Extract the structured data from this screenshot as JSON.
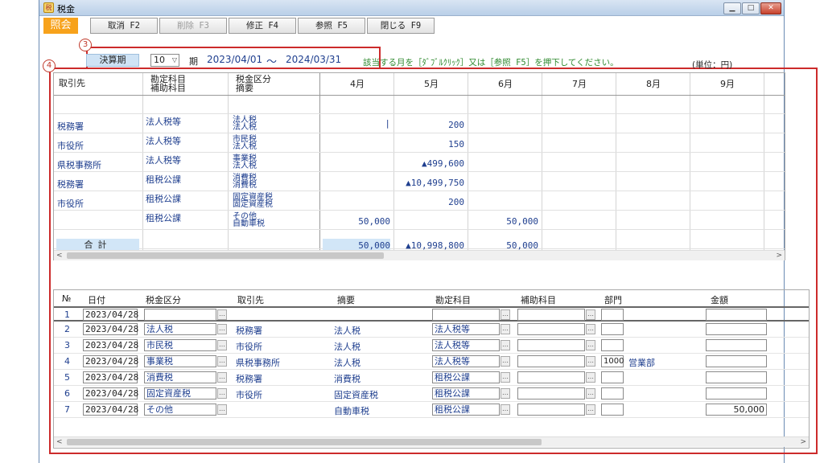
{
  "window": {
    "title": "税金",
    "icon_glyph": "税"
  },
  "mode_badge": "照会",
  "toolbar": [
    {
      "label": "取消 F2",
      "enabled": true
    },
    {
      "label": "削除 F3",
      "enabled": false
    },
    {
      "label": "修正 F4",
      "enabled": true
    },
    {
      "label": "参照 F5",
      "enabled": true
    },
    {
      "label": "閉じる F9",
      "enabled": true
    }
  ],
  "callouts": {
    "c3": "3",
    "c4": "4"
  },
  "period": {
    "label": "決算期",
    "value": "10",
    "unit": "期",
    "from": "2023/04/01",
    "tilde": "〜",
    "to": "2024/03/31"
  },
  "hint": "該当する月を［ﾀﾞﾌﾞﾙｸﾘｯｸ］又は［参照 F5］を押下してください。",
  "unit_note": "(単位：円)",
  "summary": {
    "headers": {
      "partner": "取引先",
      "account": "勘定科目",
      "sub_account": "補助科目",
      "tax_class": "税金区分",
      "memo": "摘要",
      "months": [
        "4月",
        "5月",
        "6月",
        "7月",
        "8月",
        "9月"
      ]
    },
    "rows": [
      {
        "partner": "税務署",
        "account": "法人税等",
        "tax1": "法人税",
        "tax2": "法人税",
        "apr": "|",
        "may": "200",
        "jun": ""
      },
      {
        "partner": "市役所",
        "account": "法人税等",
        "tax1": "市民税",
        "tax2": "法人税",
        "apr": "",
        "may": "150",
        "jun": ""
      },
      {
        "partner": "県税事務所",
        "account": "法人税等",
        "tax1": "事業税",
        "tax2": "法人税",
        "apr": "",
        "may": "▲499,600",
        "jun": ""
      },
      {
        "partner": "税務署",
        "account": "租税公課",
        "tax1": "消費税",
        "tax2": "消費税",
        "apr": "",
        "may": "▲10,499,750",
        "jun": ""
      },
      {
        "partner": "市役所",
        "account": "租税公課",
        "tax1": "固定資産税",
        "tax2": "固定資産税",
        "apr": "",
        "may": "200",
        "jun": ""
      },
      {
        "partner": "",
        "account": "租税公課",
        "tax1": "その他",
        "tax2": "自動車税",
        "apr": "50,000",
        "may": "",
        "jun": "50,000"
      }
    ],
    "total": {
      "label": "合計",
      "apr": "50,000",
      "may": "▲10,998,800",
      "jun": "50,000"
    }
  },
  "detail": {
    "headers": [
      "№",
      "日付",
      "税金区分",
      "取引先",
      "摘要",
      "勘定科目",
      "補助科目",
      "部門",
      "金額"
    ],
    "rows": [
      {
        "no": "1",
        "date": "2023/04/28",
        "tax": "",
        "partner": "",
        "memo": "",
        "account": "",
        "dept_code": "",
        "dept_name": "",
        "amount": ""
      },
      {
        "no": "2",
        "date": "2023/04/28",
        "tax": "法人税",
        "partner": "税務署",
        "memo": "法人税",
        "account": "法人税等",
        "dept_code": "",
        "dept_name": "",
        "amount": ""
      },
      {
        "no": "3",
        "date": "2023/04/28",
        "tax": "市民税",
        "partner": "市役所",
        "memo": "法人税",
        "account": "法人税等",
        "dept_code": "",
        "dept_name": "",
        "amount": ""
      },
      {
        "no": "4",
        "date": "2023/04/28",
        "tax": "事業税",
        "partner": "県税事務所",
        "memo": "法人税",
        "account": "法人税等",
        "dept_code": "1000",
        "dept_name": "営業部",
        "amount": ""
      },
      {
        "no": "5",
        "date": "2023/04/28",
        "tax": "消費税",
        "partner": "税務署",
        "memo": "消費税",
        "account": "租税公課",
        "dept_code": "",
        "dept_name": "",
        "amount": ""
      },
      {
        "no": "6",
        "date": "2023/04/28",
        "tax": "固定資産税",
        "partner": "市役所",
        "memo": "固定資産税",
        "account": "租税公課",
        "dept_code": "",
        "dept_name": "",
        "amount": ""
      },
      {
        "no": "7",
        "date": "2023/04/28",
        "tax": "その他",
        "partner": "",
        "memo": "自動車税",
        "account": "租税公課",
        "dept_code": "",
        "dept_name": "",
        "amount": "50,000"
      }
    ]
  },
  "colors": {
    "accent_orange": "#f7a21b",
    "callout_red": "#cc2b2b",
    "text_blue": "#1f3f8f",
    "hint_green": "#2f8a2f"
  }
}
